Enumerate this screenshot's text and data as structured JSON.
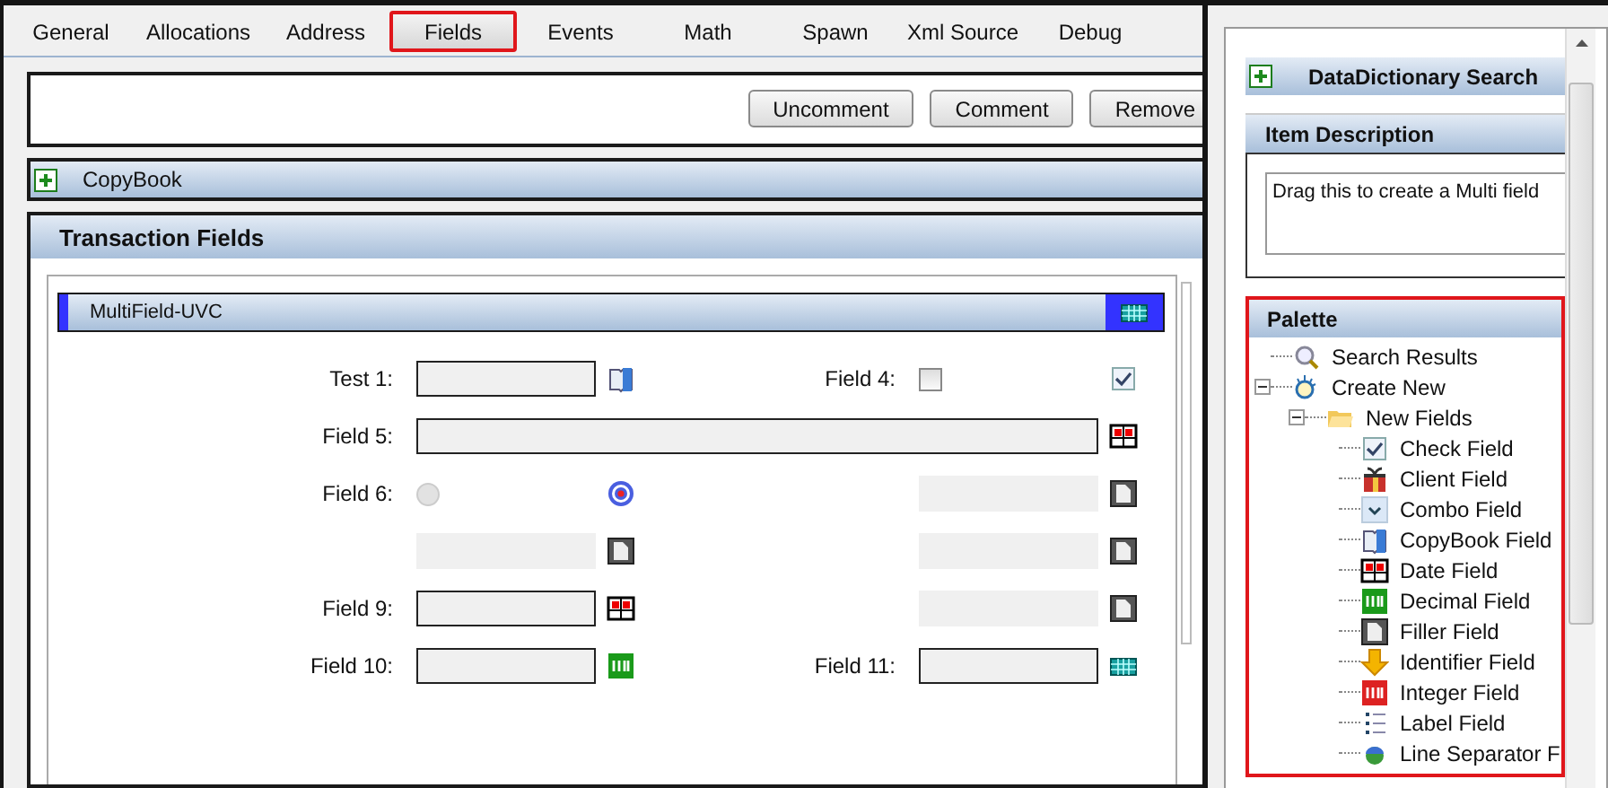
{
  "tabs": [
    {
      "label": "General",
      "selected": false
    },
    {
      "label": "Allocations",
      "selected": false
    },
    {
      "label": "Address",
      "selected": false
    },
    {
      "label": "Fields",
      "selected": true
    },
    {
      "label": "Events",
      "selected": false
    },
    {
      "label": "Math",
      "selected": false
    },
    {
      "label": "Spawn",
      "selected": false
    },
    {
      "label": "Xml Source",
      "selected": false
    },
    {
      "label": "Debug",
      "selected": false
    }
  ],
  "toolbar": {
    "buttons": [
      "Uncomment",
      "Comment",
      "Remove"
    ]
  },
  "copybook": {
    "title": "CopyBook",
    "expanded": false
  },
  "transaction_fields": {
    "title": "Transaction Fields",
    "multifield": {
      "title": "MultiField-UVC",
      "rows": [
        {
          "cells": [
            {
              "label": "Test 1:",
              "kind": "copybook"
            },
            {
              "label": "Field 4:",
              "kind": "check",
              "checked": false
            }
          ]
        },
        {
          "cells": [
            {
              "label": "Field 5:",
              "kind": "date"
            }
          ]
        },
        {
          "cells": [
            {
              "label": "Field 6:",
              "kind": "radio",
              "selected": false
            },
            {
              "kind": "filler"
            }
          ]
        },
        {
          "cells": [
            {
              "kind": "filler"
            },
            {
              "kind": "filler"
            }
          ]
        },
        {
          "cells": [
            {
              "label": "Field 9:",
              "kind": "date"
            },
            {
              "kind": "filler"
            }
          ]
        },
        {
          "cells": [
            {
              "label": "Field 10:",
              "kind": "decimal"
            },
            {
              "label": "Field 11:",
              "kind": "calendar"
            }
          ]
        }
      ]
    }
  },
  "sidebar": {
    "search": {
      "title": "DataDictionary Search",
      "expanded": false
    },
    "item_description": {
      "title": "Item Description",
      "text": "Drag this to create a Multi field"
    },
    "palette": {
      "title": "Palette",
      "highlighted": true,
      "tree": [
        {
          "label": "Search Results",
          "kind": "search"
        },
        {
          "label": "Create New",
          "kind": "create",
          "expanded": true,
          "children": [
            {
              "label": "New Fields",
              "kind": "folder",
              "expanded": true,
              "children": [
                {
                  "label": "Check Field",
                  "kind": "check"
                },
                {
                  "label": "Client Field",
                  "kind": "client"
                },
                {
                  "label": "Combo Field",
                  "kind": "combo"
                },
                {
                  "label": "CopyBook Field",
                  "kind": "copybook"
                },
                {
                  "label": "Date Field",
                  "kind": "date"
                },
                {
                  "label": "Decimal Field",
                  "kind": "decimal"
                },
                {
                  "label": "Filler Field",
                  "kind": "filler"
                },
                {
                  "label": "Identifier Field",
                  "kind": "identifier"
                },
                {
                  "label": "Integer Field",
                  "kind": "integer"
                },
                {
                  "label": "Label Field",
                  "kind": "label"
                },
                {
                  "label": "Line Separator F",
                  "kind": "separator"
                }
              ]
            }
          ]
        }
      ]
    }
  }
}
